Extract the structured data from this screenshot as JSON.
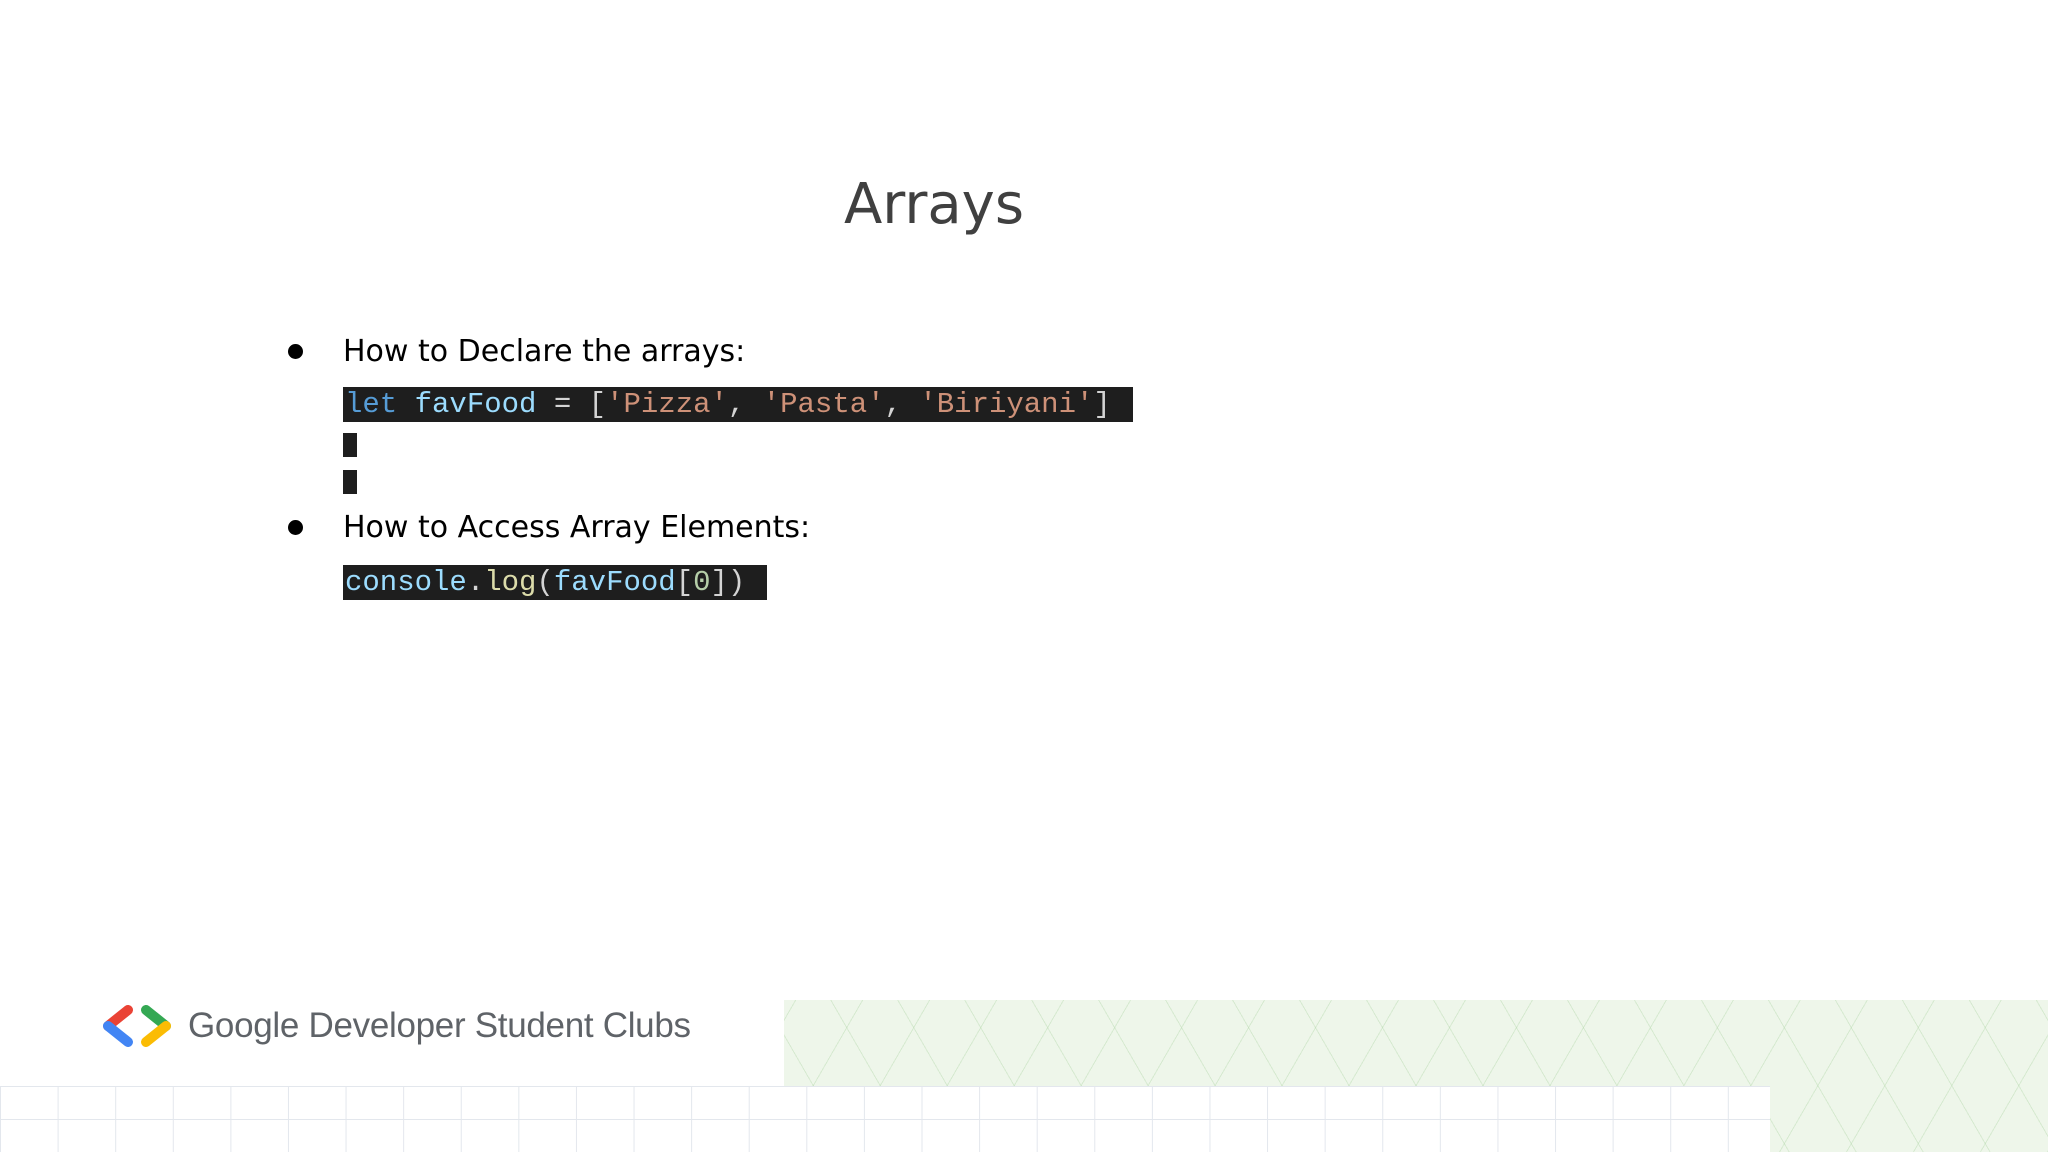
{
  "slide": {
    "title": "Arrays",
    "bullets": [
      {
        "text": "How to Declare the arrays:"
      },
      {
        "text": "How to Access Array Elements:"
      }
    ],
    "code": {
      "declare": {
        "kw": "let",
        "var": "favFood",
        "op": " = [",
        "s1": "'Pizza'",
        "c1": ", ",
        "s2": "'Pasta'",
        "c2": ", ",
        "s3": "'Biriyani'",
        "end": "]"
      },
      "access": {
        "obj": "console",
        "dot": ".",
        "fn": "log",
        "open": "(",
        "var": "favFood",
        "bopen": "[",
        "idx": "0",
        "close": "])"
      }
    }
  },
  "footer": {
    "brand_text": "Google Developer Student Clubs",
    "logo_colors": {
      "left_top": "#ea4335",
      "left_bottom": "#4285f4",
      "right_top": "#34a853",
      "right_bottom": "#fbbc04"
    }
  }
}
